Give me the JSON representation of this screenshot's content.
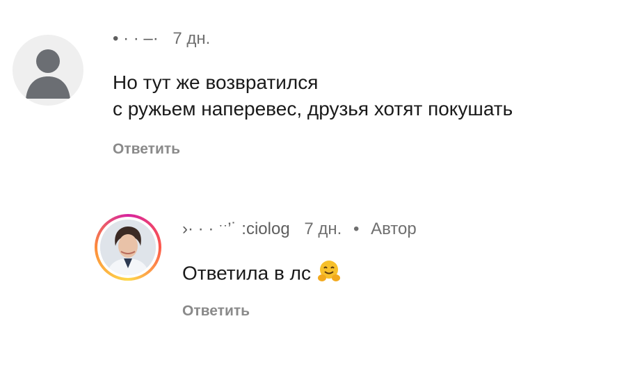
{
  "comments": [
    {
      "author": "• · · ‒·",
      "time": "7 дн.",
      "lines": [
        "Но тут же возвратился",
        "с ружьем наперевес, друзья хотят покушать"
      ],
      "reply_label": "Ответить",
      "avatar_icon": "default-user-avatar-icon"
    },
    {
      "author": "›· · · ˑˑ’˙ :ciolog",
      "time": "7 дн.",
      "separator": "•",
      "badge": "Автор",
      "text": "Ответила в лс",
      "emoji": "hugging-face-emoji",
      "reply_label": "Ответить",
      "avatar_icon": "profile-photo-avatar"
    }
  ],
  "colors": {
    "text": "#1a1a1a",
    "meta": "#6f6f6f",
    "reply": "#8a8a8a",
    "avatar_bg": "#efefef",
    "avatar_fg": "#6b6e73"
  }
}
